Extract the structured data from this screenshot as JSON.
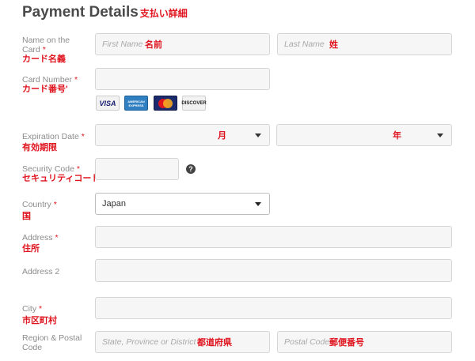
{
  "header": {
    "title": "Payment Details",
    "title_jp": "支払い詳細"
  },
  "name_on_card": {
    "label_line1": "Name on the",
    "label_line2": "Card",
    "label_jp": "カード名義",
    "first_placeholder": "First Name",
    "first_jp": "名前",
    "last_placeholder": "Last Name",
    "last_jp": "姓"
  },
  "card_number": {
    "label": "Card Number",
    "label_jp": "カード番号'",
    "card_icons": [
      "VISA",
      "AMERICAN EXPRESS",
      "MasterCard",
      "DISCOVER"
    ]
  },
  "expiration": {
    "label": "Expiration Date",
    "label_jp": "有効期限",
    "month_jp": "月",
    "year_jp": "年"
  },
  "security_code": {
    "label": "Security Code",
    "label_jp": "セキュリティコード",
    "help_glyph": "?"
  },
  "country": {
    "label": "Country",
    "label_jp": "国",
    "value": "Japan"
  },
  "address": {
    "label": "Address",
    "label_jp": "住所"
  },
  "address2": {
    "label": "Address 2"
  },
  "city": {
    "label": "City",
    "label_jp": "市区町村"
  },
  "region": {
    "label_line1": "Region & Postal",
    "label_line2": "Code",
    "state_placeholder": "State, Province or District",
    "state_jp": "都道府県",
    "postal_placeholder": "Postal Code",
    "postal_jp": "郵便番号"
  },
  "required_marker": "*",
  "colors": {
    "accent_red": "#e0141e",
    "field_bg": "#f6f6f6",
    "field_border": "#d6d6d6",
    "label_gray": "#8c8c8c"
  }
}
